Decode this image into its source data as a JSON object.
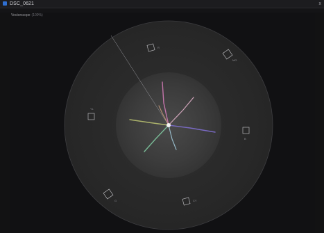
{
  "window": {
    "title": "DSC_0621",
    "close_glyph": "x"
  },
  "scope": {
    "name": "Vectorscope",
    "zoom": "(100%)",
    "targets": {
      "r": "R",
      "mg": "MG",
      "b": "B",
      "cy": "CY",
      "g": "G",
      "yl": "YL"
    }
  },
  "icons": {
    "app": "image-file-icon",
    "close": "close-icon"
  },
  "colors": {
    "accent": "#2f6fd1",
    "background": "#121213",
    "scope_outer": "#2b2b2b",
    "scope_inner": "#3a3a3a"
  }
}
